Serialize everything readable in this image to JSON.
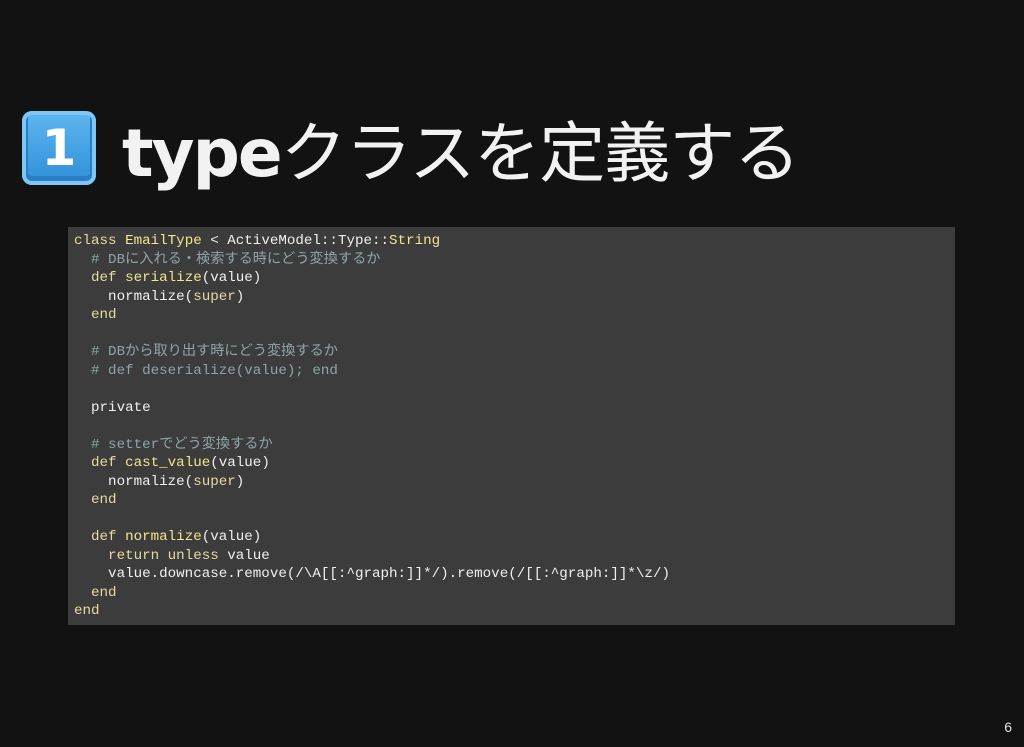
{
  "slide": {
    "keycap_number": "1",
    "title_latin": "type",
    "title_rest": "クラスを定義する",
    "page_number": "6"
  },
  "code": {
    "lines": [
      [
        {
          "t": "class ",
          "c": "kw"
        },
        {
          "t": "EmailType",
          "c": "cls"
        },
        {
          "t": " < ActiveModel::Type::",
          "c": "plain"
        },
        {
          "t": "String",
          "c": "cls"
        }
      ],
      [
        {
          "t": "  # DBに入れる・検索する時にどう変換するか",
          "c": "com"
        }
      ],
      [
        {
          "t": "  def ",
          "c": "kw"
        },
        {
          "t": "serialize",
          "c": "fn"
        },
        {
          "t": "(value)",
          "c": "plain"
        }
      ],
      [
        {
          "t": "    normalize(",
          "c": "plain"
        },
        {
          "t": "super",
          "c": "kw"
        },
        {
          "t": ")",
          "c": "plain"
        }
      ],
      [
        {
          "t": "  end",
          "c": "kw"
        }
      ],
      [
        {
          "t": "",
          "c": "plain"
        }
      ],
      [
        {
          "t": "  # DBから取り出す時にどう変換するか",
          "c": "com"
        }
      ],
      [
        {
          "t": "  # def deserialize(value); end",
          "c": "com"
        }
      ],
      [
        {
          "t": "",
          "c": "plain"
        }
      ],
      [
        {
          "t": "  private",
          "c": "plain"
        }
      ],
      [
        {
          "t": "",
          "c": "plain"
        }
      ],
      [
        {
          "t": "  # setterでどう変換するか",
          "c": "com"
        }
      ],
      [
        {
          "t": "  def ",
          "c": "kw"
        },
        {
          "t": "cast_value",
          "c": "fn"
        },
        {
          "t": "(value)",
          "c": "plain"
        }
      ],
      [
        {
          "t": "    normalize(",
          "c": "plain"
        },
        {
          "t": "super",
          "c": "kw"
        },
        {
          "t": ")",
          "c": "plain"
        }
      ],
      [
        {
          "t": "  end",
          "c": "kw"
        }
      ],
      [
        {
          "t": "",
          "c": "plain"
        }
      ],
      [
        {
          "t": "  def ",
          "c": "kw"
        },
        {
          "t": "normalize",
          "c": "fn"
        },
        {
          "t": "(value)",
          "c": "plain"
        }
      ],
      [
        {
          "t": "    return unless ",
          "c": "kw"
        },
        {
          "t": "value",
          "c": "plain"
        }
      ],
      [
        {
          "t": "    value.downcase.remove(/\\A[[:^graph:]]*/).remove(/[[:^graph:]]*\\z/)",
          "c": "plain"
        }
      ],
      [
        {
          "t": "  end",
          "c": "kw"
        }
      ],
      [
        {
          "t": "end",
          "c": "kw"
        }
      ]
    ]
  },
  "colors": {
    "background": "#121212",
    "code_background": "#3c3c3c",
    "keyword": "#e8d9a0",
    "identifier": "#f3e58c",
    "comment": "#8fa4a8",
    "keycap_blue": "#3a9be0"
  },
  "icons": {
    "keycap": "keycap-digit-one-icon"
  }
}
